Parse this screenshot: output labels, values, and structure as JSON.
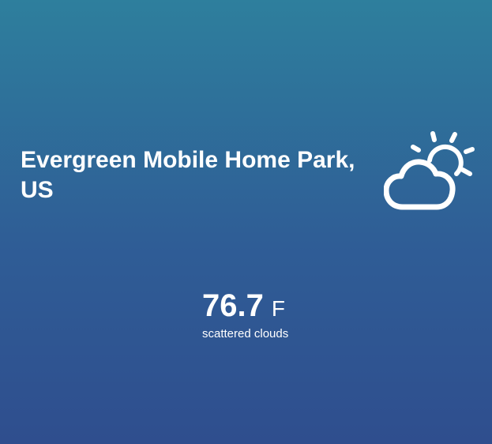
{
  "weather": {
    "location": "Evergreen Mobile Home Park, US",
    "temperature": "76.7",
    "unit": "F",
    "condition": "scattered clouds",
    "icon": "partly-cloudy-day-icon"
  },
  "colors": {
    "gradient_top": "#2e7f9d",
    "gradient_bottom": "#2f4e8e",
    "text": "#ffffff"
  }
}
